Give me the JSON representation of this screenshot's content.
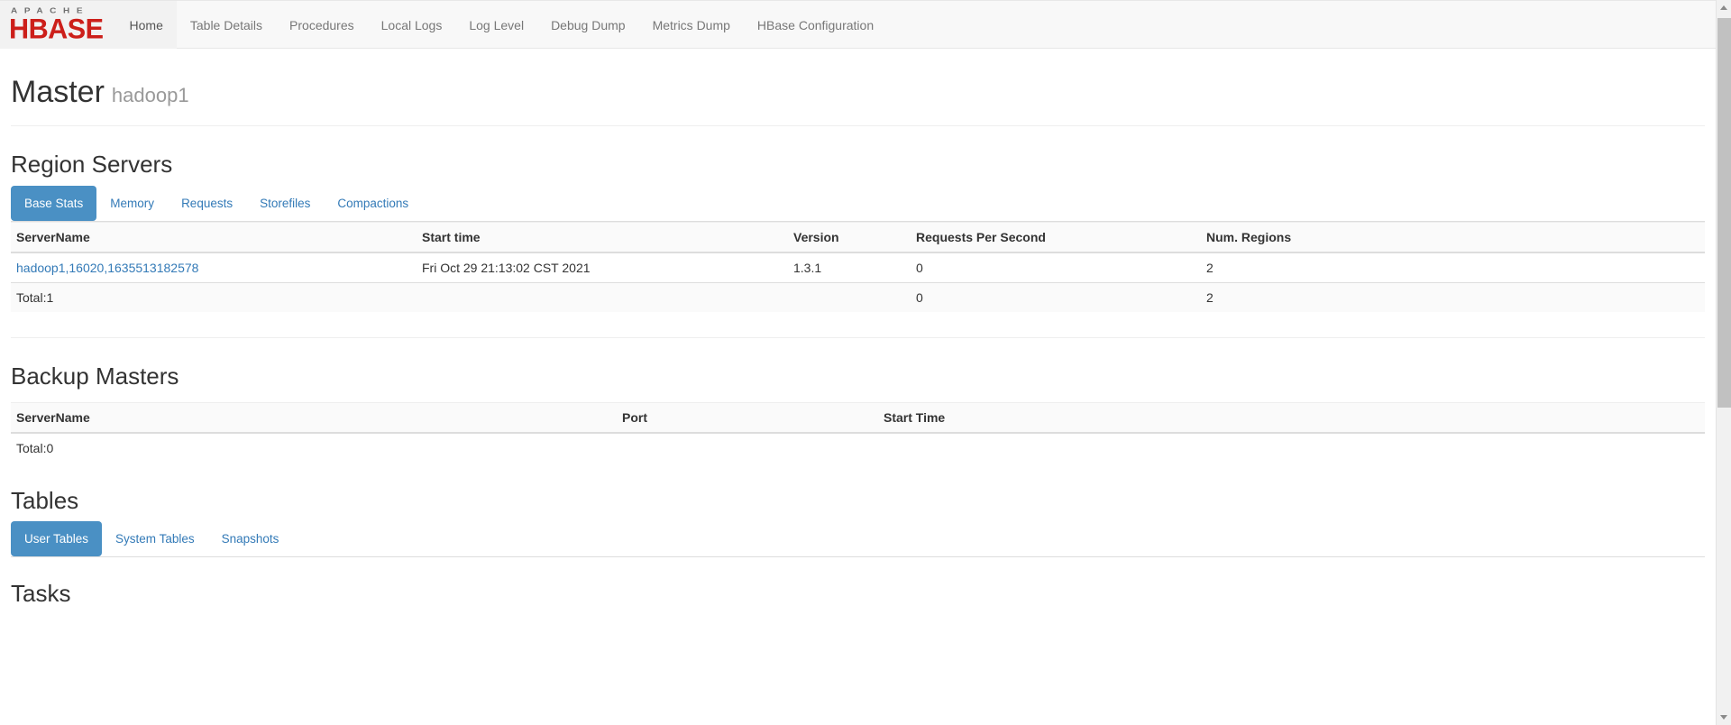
{
  "navbar": {
    "logo": {
      "top_text": "APACHE",
      "bottom_text": "HBASE"
    },
    "items": [
      {
        "label": "Home",
        "active": true
      },
      {
        "label": "Table Details",
        "active": false
      },
      {
        "label": "Procedures",
        "active": false
      },
      {
        "label": "Local Logs",
        "active": false
      },
      {
        "label": "Log Level",
        "active": false
      },
      {
        "label": "Debug Dump",
        "active": false
      },
      {
        "label": "Metrics Dump",
        "active": false
      },
      {
        "label": "HBase Configuration",
        "active": false
      }
    ]
  },
  "page": {
    "title": "Master",
    "subtitle": "hadoop1"
  },
  "region_servers": {
    "heading": "Region Servers",
    "tabs": [
      {
        "label": "Base Stats",
        "active": true
      },
      {
        "label": "Memory",
        "active": false
      },
      {
        "label": "Requests",
        "active": false
      },
      {
        "label": "Storefiles",
        "active": false
      },
      {
        "label": "Compactions",
        "active": false
      }
    ],
    "columns": [
      "ServerName",
      "Start time",
      "Version",
      "Requests Per Second",
      "Num. Regions"
    ],
    "rows": [
      {
        "server_name": "hadoop1,16020,1635513182578",
        "start_time": "Fri Oct 29 21:13:02 CST 2021",
        "version": "1.3.1",
        "requests_per_second": "0",
        "num_regions": "2"
      }
    ],
    "total": {
      "label": "Total:1",
      "start_time": "",
      "version": "",
      "requests_per_second": "0",
      "num_regions": "2"
    }
  },
  "backup_masters": {
    "heading": "Backup Masters",
    "columns": [
      "ServerName",
      "Port",
      "Start Time"
    ],
    "rows": [],
    "total": {
      "label": "Total:0"
    }
  },
  "tables": {
    "heading": "Tables",
    "tabs": [
      {
        "label": "User Tables",
        "active": true
      },
      {
        "label": "System Tables",
        "active": false
      },
      {
        "label": "Snapshots",
        "active": false
      }
    ]
  },
  "tasks": {
    "heading": "Tasks"
  },
  "colors": {
    "brand_red": "#cc1f1a",
    "link_blue": "#337ab7",
    "active_tab_blue": "#4a90c4",
    "navbar_bg": "#f8f8f8"
  }
}
